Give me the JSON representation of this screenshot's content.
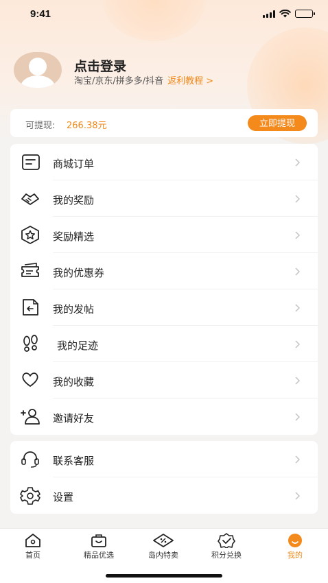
{
  "status_bar": {
    "time": "9:41"
  },
  "profile": {
    "login_title": "点击登录",
    "platforms": "淘宝/京东/拼多多/抖音",
    "tutorial_link": "返利教程 >"
  },
  "withdraw": {
    "label": "可提现:",
    "amount": "266.38元",
    "button": "立即提现"
  },
  "menu_main": [
    {
      "label": "商城订单",
      "icon": "order-list-icon"
    },
    {
      "label": "我的奖励",
      "icon": "reward-handshake-icon"
    },
    {
      "label": "奖励精选",
      "icon": "star-hexagon-icon"
    },
    {
      "label": "我的优惠券",
      "icon": "coupon-icon"
    },
    {
      "label": "我的发帖",
      "icon": "post-icon"
    },
    {
      "label": "我的足迹",
      "icon": "footprint-icon"
    },
    {
      "label": "我的收藏",
      "icon": "heart-icon"
    },
    {
      "label": "邀请好友",
      "icon": "add-friend-icon"
    }
  ],
  "menu_secondary": [
    {
      "label": "联系客服",
      "icon": "headset-icon"
    },
    {
      "label": "设置",
      "icon": "gear-icon"
    }
  ],
  "tabbar": [
    {
      "label": "首页",
      "icon": "home-icon"
    },
    {
      "label": "精品优选",
      "icon": "basket-icon"
    },
    {
      "label": "岛内特卖",
      "icon": "sale-tag-icon"
    },
    {
      "label": "积分兑换",
      "icon": "points-badge-icon"
    },
    {
      "label": "我的",
      "icon": "profile-blob-icon",
      "active": true
    }
  ],
  "colors": {
    "accent": "#f4891c",
    "accent_text": "#f08a1c",
    "background": "#f4f3f2"
  }
}
